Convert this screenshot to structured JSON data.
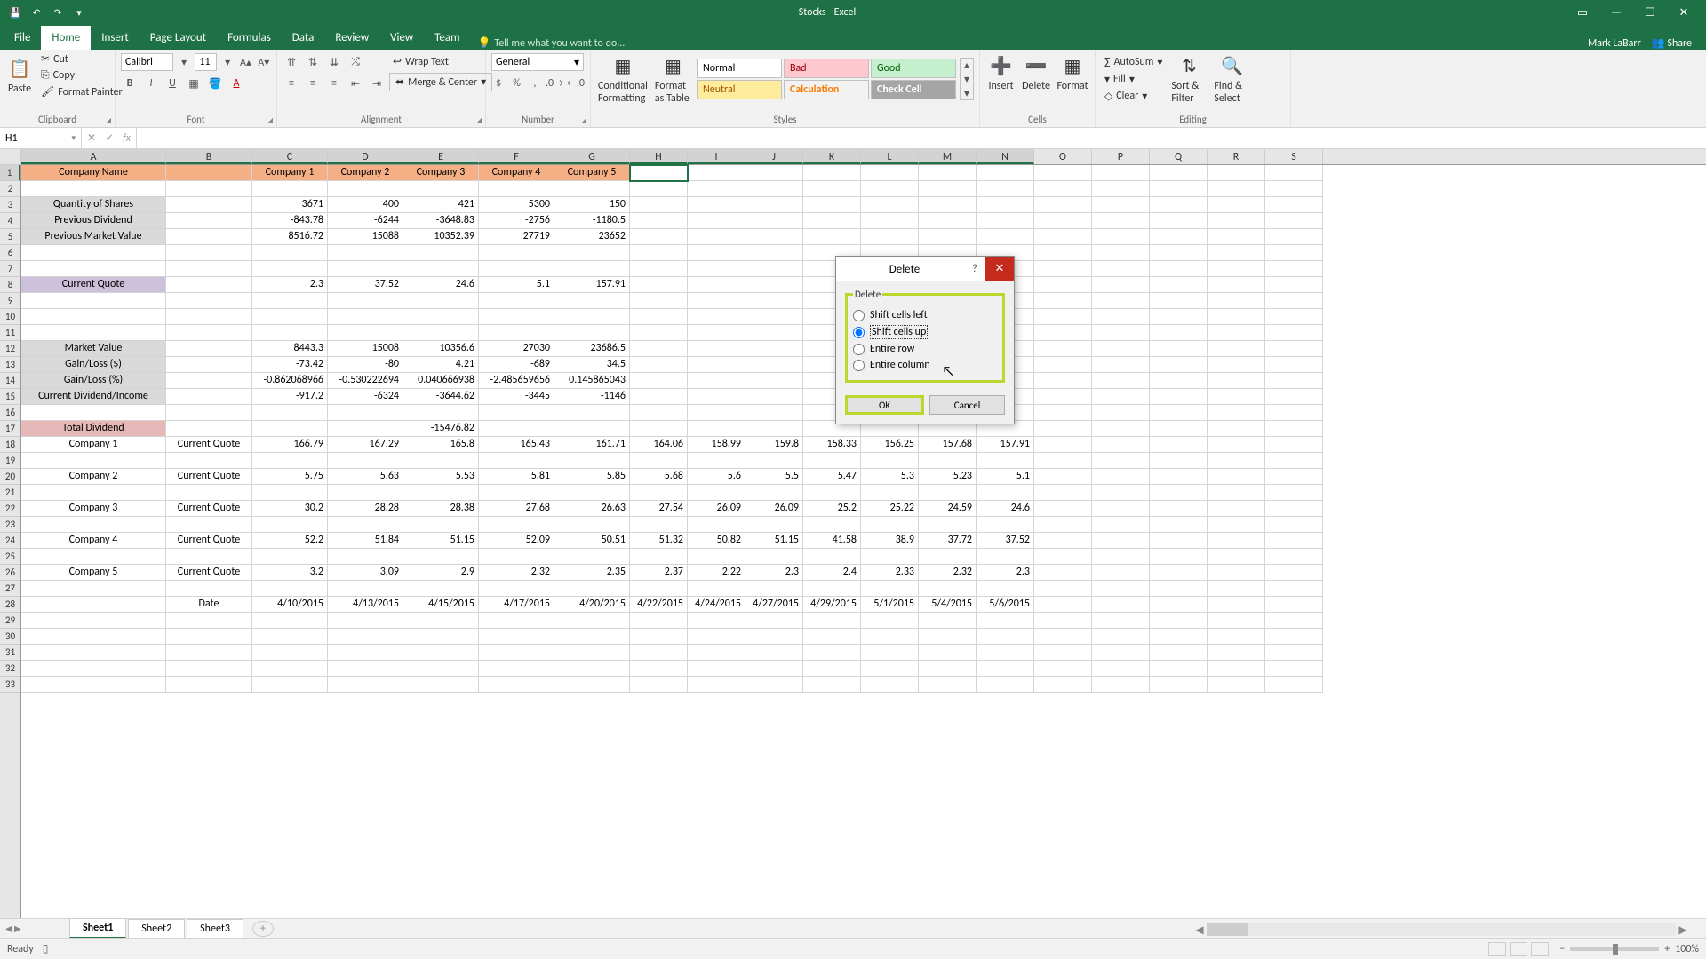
{
  "title": "Stocks - Excel",
  "user": "Mark LaBarr",
  "share": "Share",
  "tabs": [
    "File",
    "Home",
    "Insert",
    "Page Layout",
    "Formulas",
    "Data",
    "Review",
    "View",
    "Team"
  ],
  "active_tab": "Home",
  "tellme": "Tell me what you want to do...",
  "ribbon": {
    "clipboard": {
      "label": "Clipboard",
      "paste": "Paste",
      "cut": "Cut",
      "copy": "Copy",
      "fp": "Format Painter"
    },
    "font": {
      "label": "Font",
      "name": "Calibri",
      "size": "11"
    },
    "alignment": {
      "label": "Alignment",
      "wrap": "Wrap Text",
      "merge": "Merge & Center"
    },
    "number": {
      "label": "Number",
      "format": "General"
    },
    "styles": {
      "label": "Styles",
      "cf": "Conditional Formatting",
      "fat": "Format as Table",
      "normal": "Normal",
      "bad": "Bad",
      "good": "Good",
      "neutral": "Neutral",
      "calc": "Calculation",
      "check": "Check Cell"
    },
    "cells": {
      "label": "Cells",
      "insert": "Insert",
      "delete": "Delete",
      "format": "Format"
    },
    "editing": {
      "label": "Editing",
      "autosum": "AutoSum",
      "fill": "Fill",
      "clear": "Clear",
      "sortfilter": "Sort & Filter",
      "findselect": "Find & Select"
    }
  },
  "namebox": "H1",
  "dialog": {
    "title": "Delete",
    "group": "Delete",
    "opt_left": "Shift cells left",
    "opt_up": "Shift cells up",
    "opt_row": "Entire row",
    "opt_col": "Entire column",
    "ok": "OK",
    "cancel": "Cancel"
  },
  "sheets": [
    "Sheet1",
    "Sheet2",
    "Sheet3"
  ],
  "status": {
    "ready": "Ready",
    "zoom": "100%"
  },
  "columns": [
    "A",
    "B",
    "C",
    "D",
    "E",
    "F",
    "G",
    "H",
    "I",
    "J",
    "K",
    "L",
    "M",
    "N",
    "O",
    "P",
    "Q",
    "R",
    "S"
  ],
  "selected_col_range": [
    0,
    13
  ],
  "grid": {
    "r1": {
      "A": "Company Name",
      "C": "Company 1",
      "D": "Company 2",
      "E": "Company 3",
      "F": "Company 4",
      "G": "Company 5"
    },
    "r3": {
      "A": "Quantity of Shares",
      "C": "3671",
      "D": "400",
      "E": "421",
      "F": "5300",
      "G": "150"
    },
    "r4": {
      "A": "Previous Dividend",
      "C": "-843.78",
      "D": "-6244",
      "E": "-3648.83",
      "F": "-2756",
      "G": "-1180.5"
    },
    "r5": {
      "A": "Previous Market Value",
      "C": "8516.72",
      "D": "15088",
      "E": "10352.39",
      "F": "27719",
      "G": "23652"
    },
    "r8": {
      "A": "Current Quote",
      "C": "2.3",
      "D": "37.52",
      "E": "24.6",
      "F": "5.1",
      "G": "157.91"
    },
    "r12": {
      "A": "Market Value",
      "C": "8443.3",
      "D": "15008",
      "E": "10356.6",
      "F": "27030",
      "G": "23686.5"
    },
    "r13": {
      "A": "Gain/Loss ($)",
      "C": "-73.42",
      "D": "-80",
      "E": "4.21",
      "F": "-689",
      "G": "34.5"
    },
    "r14": {
      "A": "Gain/Loss (%)",
      "C": "-0.862068966",
      "D": "-0.530222694",
      "E": "0.040666938",
      "F": "-2.485659656",
      "G": "0.145865043"
    },
    "r15": {
      "A": "Current Dividend/Income",
      "C": "-917.2",
      "D": "-6324",
      "E": "-3644.62",
      "F": "-3445",
      "G": "-1146"
    },
    "r17": {
      "A": "Total Dividend",
      "E": "-15476.82"
    },
    "r18": {
      "A": "Company 1",
      "B": "Current Quote",
      "C": "166.79",
      "D": "167.29",
      "E": "165.8",
      "F": "165.43",
      "G": "161.71",
      "H": "164.06",
      "I": "158.99",
      "J": "159.8",
      "K": "158.33",
      "L": "156.25",
      "M": "157.68",
      "N": "157.91"
    },
    "r20": {
      "A": "Company 2",
      "B": "Current Quote",
      "C": "5.75",
      "D": "5.63",
      "E": "5.53",
      "F": "5.81",
      "G": "5.85",
      "H": "5.68",
      "I": "5.6",
      "J": "5.5",
      "K": "5.47",
      "L": "5.3",
      "M": "5.23",
      "N": "5.1"
    },
    "r22": {
      "A": "Company 3",
      "B": "Current Quote",
      "C": "30.2",
      "D": "28.28",
      "E": "28.38",
      "F": "27.68",
      "G": "26.63",
      "H": "27.54",
      "I": "26.09",
      "J": "26.09",
      "K": "25.2",
      "L": "25.22",
      "M": "24.59",
      "N": "24.6"
    },
    "r24": {
      "A": "Company 4",
      "B": "Current Quote",
      "C": "52.2",
      "D": "51.84",
      "E": "51.15",
      "F": "52.09",
      "G": "50.51",
      "H": "51.32",
      "I": "50.82",
      "J": "51.15",
      "K": "41.58",
      "L": "38.9",
      "M": "37.72",
      "N": "37.52"
    },
    "r26": {
      "A": "Company 5",
      "B": "Current Quote",
      "C": "3.2",
      "D": "3.09",
      "E": "2.9",
      "F": "2.32",
      "G": "2.35",
      "H": "2.37",
      "I": "2.22",
      "J": "2.3",
      "K": "2.4",
      "L": "2.33",
      "M": "2.32",
      "N": "2.3"
    },
    "r28": {
      "B": "Date",
      "C": "4/10/2015",
      "D": "4/13/2015",
      "E": "4/15/2015",
      "F": "4/17/2015",
      "G": "4/20/2015",
      "H": "4/22/2015",
      "I": "4/24/2015",
      "J": "4/27/2015",
      "K": "4/29/2015",
      "L": "5/1/2015",
      "M": "5/4/2015",
      "N": "5/6/2015"
    }
  }
}
